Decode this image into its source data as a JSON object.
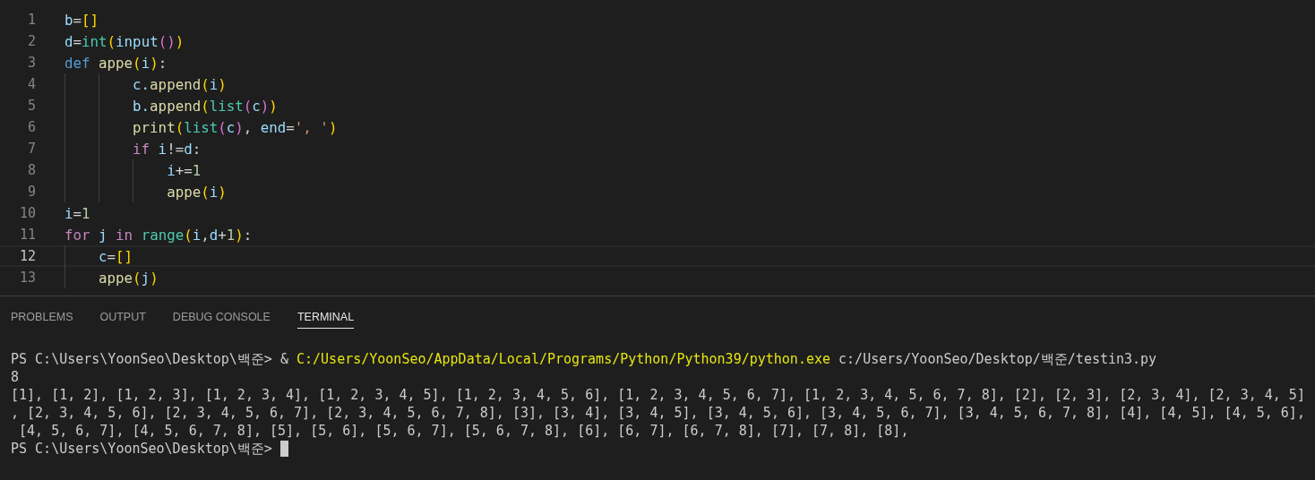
{
  "editor": {
    "lines": [
      {
        "number": "1",
        "current": false,
        "spans": [
          {
            "text": "b",
            "color": "#9cdcfe"
          },
          {
            "text": "=",
            "color": "#d4d4d4"
          },
          {
            "text": "[]",
            "color": "#ffd700"
          }
        ]
      },
      {
        "number": "2",
        "current": false,
        "spans": [
          {
            "text": "d",
            "color": "#9cdcfe"
          },
          {
            "text": "=",
            "color": "#d4d4d4"
          },
          {
            "text": "int",
            "color": "#4ec9b0"
          },
          {
            "text": "(",
            "color": "#ffd700"
          },
          {
            "text": "input",
            "color": "#9cdcfe"
          },
          {
            "text": "()",
            "color": "#da70d6"
          },
          {
            "text": ")",
            "color": "#ffd700"
          }
        ]
      },
      {
        "number": "3",
        "current": false,
        "spans": [
          {
            "text": "def",
            "color": "#569cd6"
          },
          {
            "text": " appe",
            "color": "#dcdcaa"
          },
          {
            "text": "(",
            "color": "#ffd700"
          },
          {
            "text": "i",
            "color": "#9cdcfe"
          },
          {
            "text": ")",
            "color": "#ffd700"
          },
          {
            "text": ":",
            "color": "#d4d4d4"
          }
        ]
      },
      {
        "number": "4",
        "current": false,
        "spans": [
          {
            "text": "        c.",
            "color": "#9cdcfe"
          },
          {
            "text": "append",
            "color": "#dcdcaa"
          },
          {
            "text": "(",
            "color": "#ffd700"
          },
          {
            "text": "i",
            "color": "#9cdcfe"
          },
          {
            "text": ")",
            "color": "#ffd700"
          }
        ]
      },
      {
        "number": "5",
        "current": false,
        "spans": [
          {
            "text": "        b.",
            "color": "#9cdcfe"
          },
          {
            "text": "append",
            "color": "#dcdcaa"
          },
          {
            "text": "(",
            "color": "#ffd700"
          },
          {
            "text": "list",
            "color": "#4ec9b0"
          },
          {
            "text": "(",
            "color": "#da70d6"
          },
          {
            "text": "c",
            "color": "#9cdcfe"
          },
          {
            "text": ")",
            "color": "#da70d6"
          },
          {
            "text": ")",
            "color": "#ffd700"
          }
        ]
      },
      {
        "number": "6",
        "current": false,
        "spans": [
          {
            "text": "        print",
            "color": "#dcdcaa"
          },
          {
            "text": "(",
            "color": "#ffd700"
          },
          {
            "text": "list",
            "color": "#4ec9b0"
          },
          {
            "text": "(",
            "color": "#da70d6"
          },
          {
            "text": "c",
            "color": "#9cdcfe"
          },
          {
            "text": ")",
            "color": "#da70d6"
          },
          {
            "text": ",",
            "color": "#d4d4d4"
          },
          {
            "text": " end",
            "color": "#9cdcfe"
          },
          {
            "text": "=",
            "color": "#d4d4d4"
          },
          {
            "text": "', '",
            "color": "#ce9178"
          },
          {
            "text": ")",
            "color": "#ffd700"
          }
        ]
      },
      {
        "number": "7",
        "current": false,
        "spans": [
          {
            "text": "        if",
            "color": "#c586c0"
          },
          {
            "text": " i",
            "color": "#9cdcfe"
          },
          {
            "text": "!=",
            "color": "#d4d4d4"
          },
          {
            "text": "d",
            "color": "#9cdcfe"
          },
          {
            "text": ":",
            "color": "#d4d4d4"
          }
        ]
      },
      {
        "number": "8",
        "current": false,
        "spans": [
          {
            "text": "            i",
            "color": "#9cdcfe"
          },
          {
            "text": "+=",
            "color": "#d4d4d4"
          },
          {
            "text": "1",
            "color": "#b5cea8"
          }
        ]
      },
      {
        "number": "9",
        "current": false,
        "spans": [
          {
            "text": "            appe",
            "color": "#dcdcaa"
          },
          {
            "text": "(",
            "color": "#ffd700"
          },
          {
            "text": "i",
            "color": "#9cdcfe"
          },
          {
            "text": ")",
            "color": "#ffd700"
          }
        ]
      },
      {
        "number": "10",
        "current": false,
        "spans": [
          {
            "text": "i",
            "color": "#9cdcfe"
          },
          {
            "text": "=",
            "color": "#d4d4d4"
          },
          {
            "text": "1",
            "color": "#b5cea8"
          }
        ]
      },
      {
        "number": "11",
        "current": false,
        "spans": [
          {
            "text": "for",
            "color": "#c586c0"
          },
          {
            "text": " j",
            "color": "#9cdcfe"
          },
          {
            "text": " in",
            "color": "#c586c0"
          },
          {
            "text": " range",
            "color": "#4ec9b0"
          },
          {
            "text": "(",
            "color": "#ffd700"
          },
          {
            "text": "i",
            "color": "#9cdcfe"
          },
          {
            "text": ",",
            "color": "#d4d4d4"
          },
          {
            "text": "d",
            "color": "#9cdcfe"
          },
          {
            "text": "+",
            "color": "#d4d4d4"
          },
          {
            "text": "1",
            "color": "#b5cea8"
          },
          {
            "text": ")",
            "color": "#ffd700"
          },
          {
            "text": ":",
            "color": "#d4d4d4"
          }
        ]
      },
      {
        "number": "12",
        "current": true,
        "spans": [
          {
            "text": "    c",
            "color": "#9cdcfe"
          },
          {
            "text": "=",
            "color": "#d4d4d4"
          },
          {
            "text": "[]",
            "color": "#ffd700"
          }
        ]
      },
      {
        "number": "13",
        "current": false,
        "spans": [
          {
            "text": "    appe",
            "color": "#dcdcaa"
          },
          {
            "text": "(",
            "color": "#ffd700"
          },
          {
            "text": "j",
            "color": "#9cdcfe"
          },
          {
            "text": ")",
            "color": "#ffd700"
          }
        ]
      }
    ]
  },
  "panel": {
    "tabs": [
      {
        "label": "PROBLEMS",
        "selected": false
      },
      {
        "label": "OUTPUT",
        "selected": false
      },
      {
        "label": "DEBUG CONSOLE",
        "selected": false
      },
      {
        "label": "TERMINAL",
        "selected": true
      }
    ],
    "terminal": {
      "lines": [
        [
          {
            "text": "PS C:\\Users\\YoonSeo\\Desktop\\백준> & ",
            "color": "#cccccc"
          },
          {
            "text": "C:/Users/YoonSeo/AppData/Local/Programs/Python/Python39/python.exe",
            "color": "#e5e510"
          },
          {
            "text": " c:/Users/YoonSeo/Desktop/백준/testin3.py",
            "color": "#cccccc"
          }
        ],
        [
          {
            "text": "8",
            "color": "#cccccc"
          }
        ],
        [
          {
            "text": "[1], [1, 2], [1, 2, 3], [1, 2, 3, 4], [1, 2, 3, 4, 5], [1, 2, 3, 4, 5, 6], [1, 2, 3, 4, 5, 6, 7], [1, 2, 3, 4, 5, 6, 7, 8], [2], [2, 3], [2, 3, 4], [2, 3, 4, 5]",
            "color": "#cccccc"
          }
        ],
        [
          {
            "text": ", [2, 3, 4, 5, 6], [2, 3, 4, 5, 6, 7], [2, 3, 4, 5, 6, 7, 8], [3], [3, 4], [3, 4, 5], [3, 4, 5, 6], [3, 4, 5, 6, 7], [3, 4, 5, 6, 7, 8], [4], [4, 5], [4, 5, 6],",
            "color": "#cccccc"
          }
        ],
        [
          {
            "text": " [4, 5, 6, 7], [4, 5, 6, 7, 8], [5], [5, 6], [5, 6, 7], [5, 6, 7, 8], [6], [6, 7], [6, 7, 8], [7], [7, 8], [8],",
            "color": "#cccccc"
          }
        ],
        [
          {
            "text": "PS C:\\Users\\YoonSeo\\Desktop\\백준> ",
            "color": "#cccccc"
          }
        ]
      ],
      "cursor": true
    }
  }
}
